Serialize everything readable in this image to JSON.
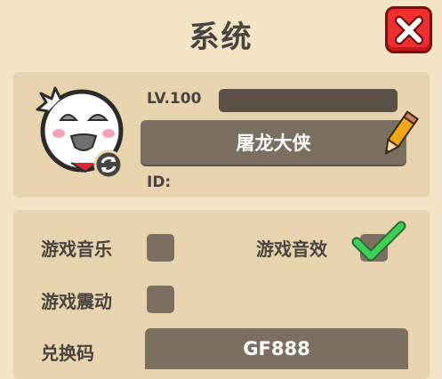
{
  "header": {
    "title": "系统"
  },
  "profile": {
    "level_label": "LV.100",
    "name": "屠龙大侠",
    "id_label": "ID:"
  },
  "settings": {
    "music_label": "游戏音乐",
    "music_enabled": false,
    "sound_label": "游戏音效",
    "sound_enabled": true,
    "vibration_label": "游戏震动",
    "vibration_enabled": false,
    "redeem_label": "兑换码",
    "redeem_value": "GF888"
  },
  "colors": {
    "background": "#f3e4c6",
    "card": "#e7d3ad",
    "control": "#7b6f61",
    "close_button": "#ef2f2f",
    "check": "#3ecf57"
  }
}
